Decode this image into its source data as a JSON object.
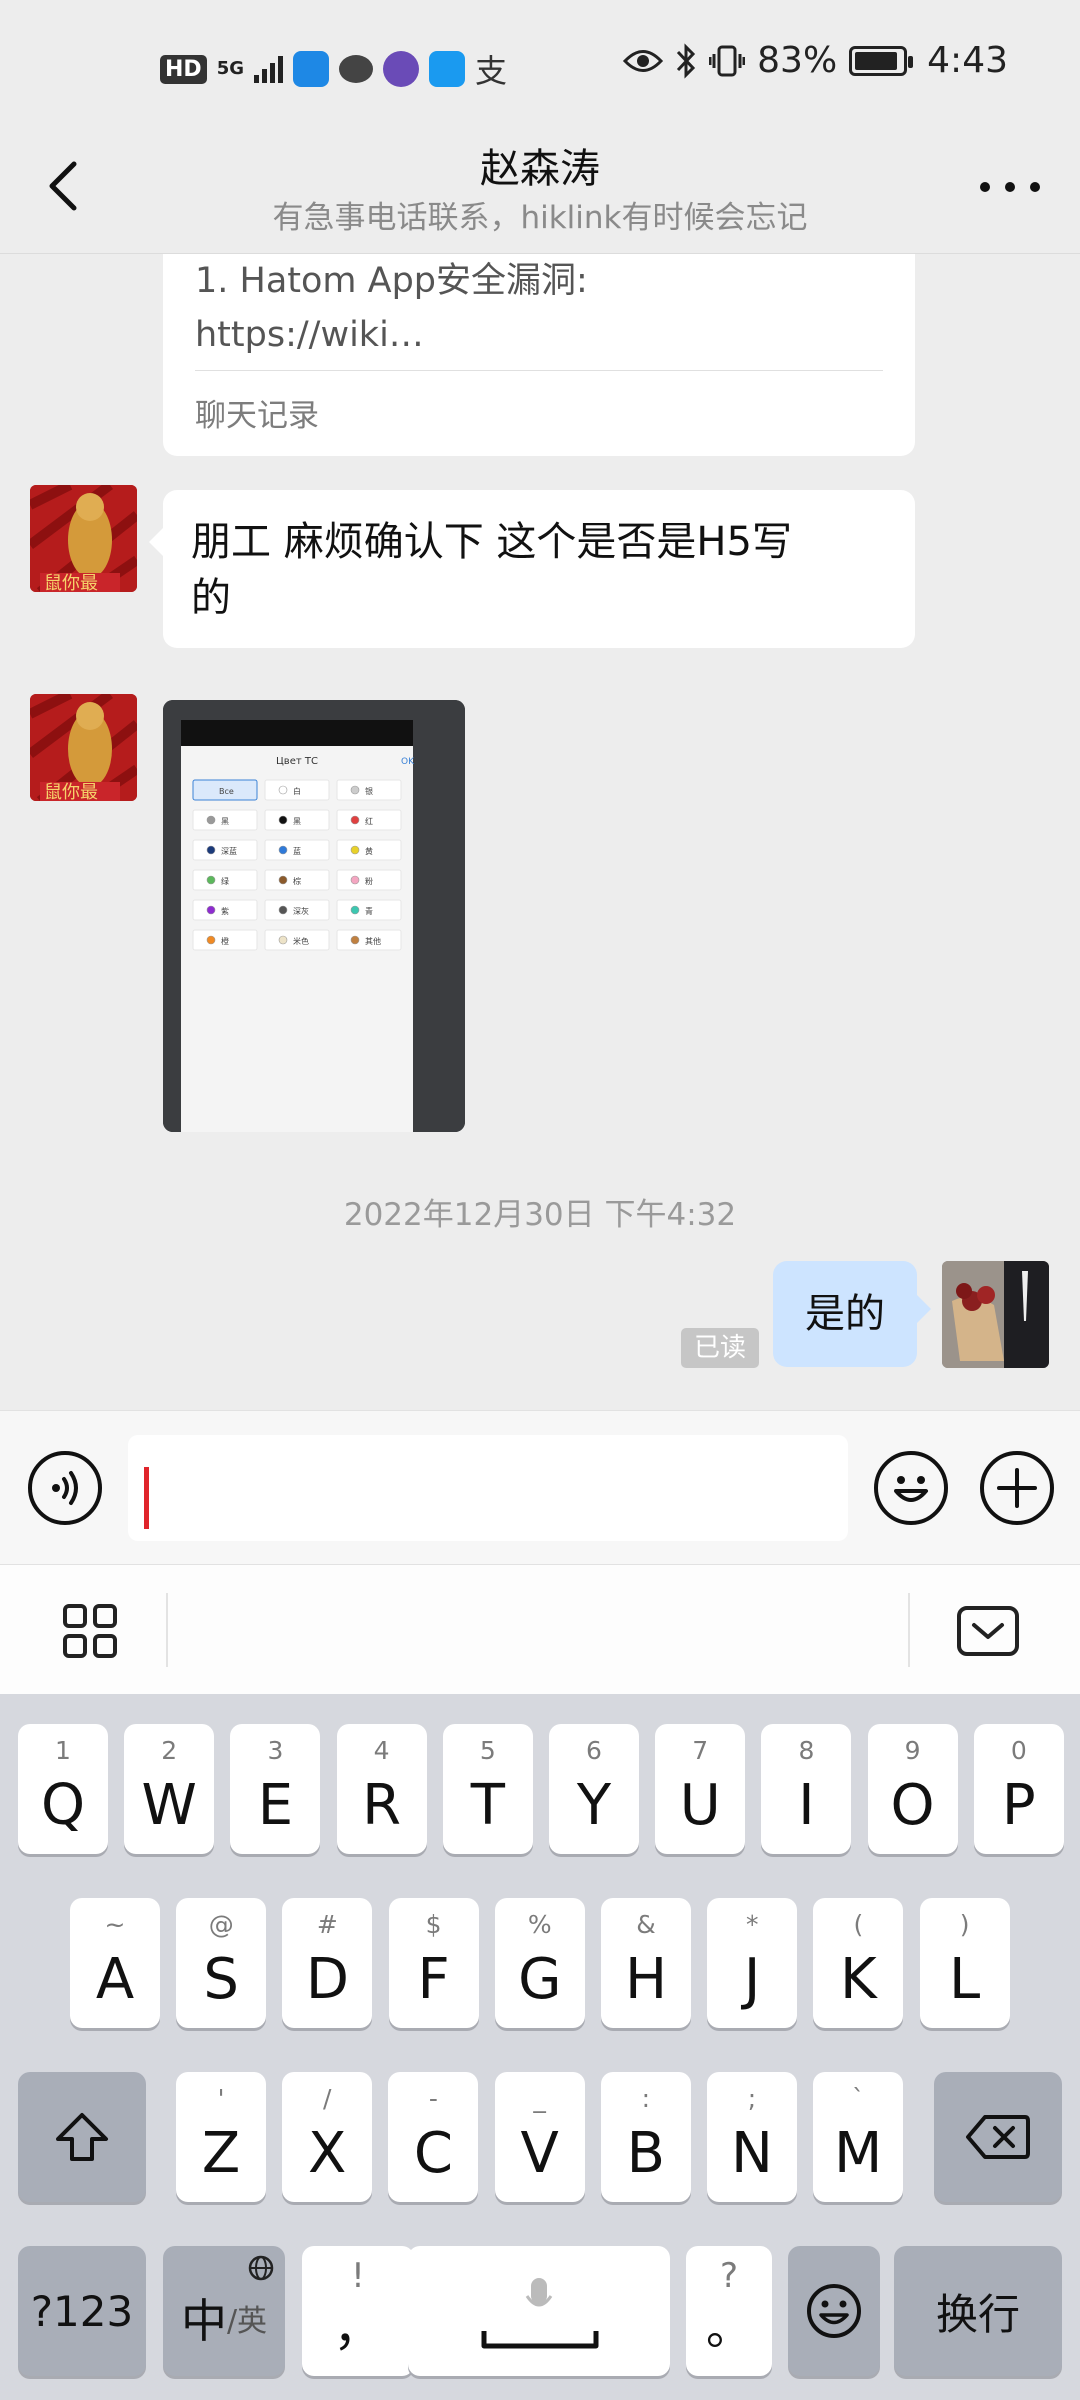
{
  "status_bar": {
    "hd": "HD",
    "network": "5G",
    "battery": "83%",
    "time": "4:43",
    "icons": [
      "hd-icon",
      "signal-icon",
      "weather-app-icon",
      "messages-icon",
      "camera-app-icon",
      "search-app-icon",
      "alipay-icon",
      "eye-icon",
      "bluetooth-icon",
      "vibrate-icon",
      "battery-icon"
    ]
  },
  "header": {
    "title": "赵森涛",
    "subtitle": "有急事电话联系，hiklink有时候会忘记"
  },
  "messages": {
    "card": {
      "line1": "1. Hatom App安全漏洞:",
      "line2": "https://wiki…",
      "footer": "聊天记录"
    },
    "text1": {
      "line1": "朋工  麻烦确认下  这个是否是H5写",
      "line2": "的"
    },
    "screenshot": {
      "title": "Цвет ТС",
      "ok": "OK",
      "options": [
        "Все",
        "白",
        "银",
        "黑",
        "黑",
        "红",
        "深蓝",
        "蓝",
        "黄",
        "绿",
        "棕",
        "粉",
        "紫",
        "深灰",
        "青",
        "橙",
        "米色",
        "其他"
      ]
    },
    "timestamp": "2022年12月30日 下午4:32",
    "reply": "是的",
    "read_status": "已读"
  },
  "input": {
    "value": ""
  },
  "keyboard": {
    "row1": [
      {
        "hint": "1",
        "key": "Q"
      },
      {
        "hint": "2",
        "key": "W"
      },
      {
        "hint": "3",
        "key": "E"
      },
      {
        "hint": "4",
        "key": "R"
      },
      {
        "hint": "5",
        "key": "T"
      },
      {
        "hint": "6",
        "key": "Y"
      },
      {
        "hint": "7",
        "key": "U"
      },
      {
        "hint": "8",
        "key": "I"
      },
      {
        "hint": "9",
        "key": "O"
      },
      {
        "hint": "0",
        "key": "P"
      }
    ],
    "row2": [
      {
        "hint": "~",
        "key": "A"
      },
      {
        "hint": "@",
        "key": "S"
      },
      {
        "hint": "#",
        "key": "D"
      },
      {
        "hint": "$",
        "key": "F"
      },
      {
        "hint": "%",
        "key": "G"
      },
      {
        "hint": "&",
        "key": "H"
      },
      {
        "hint": "*",
        "key": "J"
      },
      {
        "hint": "(",
        "key": "K"
      },
      {
        "hint": ")",
        "key": "L"
      }
    ],
    "row3": [
      {
        "hint": "'",
        "key": "Z"
      },
      {
        "hint": "/",
        "key": "X"
      },
      {
        "hint": "-",
        "key": "C"
      },
      {
        "hint": "_",
        "key": "V"
      },
      {
        "hint": ":",
        "key": "B"
      },
      {
        "hint": ";",
        "key": "N"
      },
      {
        "hint": "`",
        "key": "M"
      }
    ],
    "row4": {
      "num": "?123",
      "lang_main": "中",
      "lang_sub": "/英",
      "comma_hint": "!",
      "comma": "，",
      "period_hint": "?",
      "period": "。",
      "enter": "换行"
    }
  }
}
